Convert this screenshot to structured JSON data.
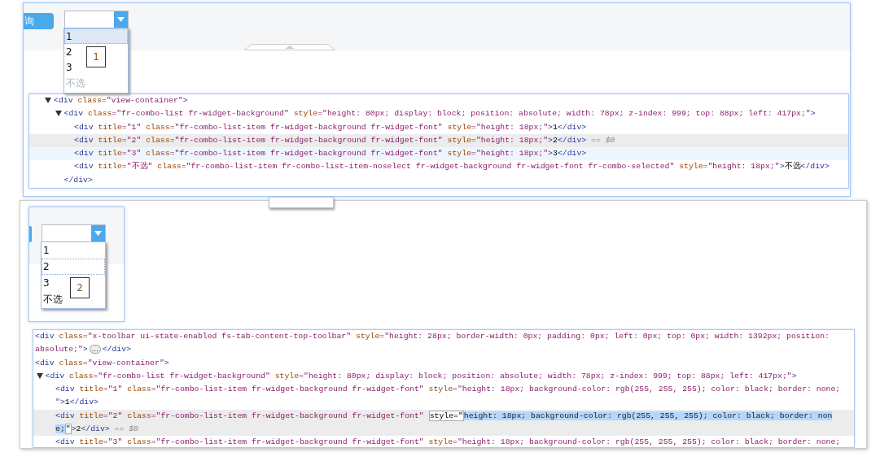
{
  "shots": [
    {
      "button": "询",
      "annotation": "1",
      "combo": {
        "items": [
          {
            "text": "1",
            "selected": true,
            "focused": true,
            "muted": false
          },
          {
            "text": "2",
            "selected": false,
            "focused": false,
            "muted": false
          },
          {
            "text": "3",
            "selected": false,
            "focused": false,
            "muted": false
          },
          {
            "text": "不选",
            "selected": false,
            "focused": false,
            "muted": true
          }
        ]
      },
      "tree": [
        {
          "expanded": true,
          "lines": [
            [
              {
                "kind": "tag",
                "text": "<div"
              },
              {
                "kind": "attr",
                "text": " class"
              },
              {
                "kind": "value",
                "text": "=\"view-container\""
              },
              {
                "kind": "tag",
                "text": ">"
              }
            ]
          ],
          "children": [
            {
              "expanded": true,
              "lines": [
                [
                  {
                    "kind": "tag",
                    "text": "<div"
                  },
                  {
                    "kind": "attr",
                    "text": " class"
                  },
                  {
                    "kind": "value",
                    "text": "=\"fr-combo-list fr-widget-background\""
                  },
                  {
                    "kind": "attr",
                    "text": " style"
                  },
                  {
                    "kind": "value",
                    "text": "=\"height: 80px; display: block; position: absolute; width: 78px; z-index: 999; top: 88px; left: 417px;\""
                  },
                  {
                    "kind": "tag",
                    "text": ">"
                  }
                ]
              ],
              "children": [
                {
                  "selected": false,
                  "hovered": false,
                  "lines": [
                    [
                      {
                        "kind": "tag",
                        "text": "<div"
                      },
                      {
                        "kind": "attr",
                        "text": " title"
                      },
                      {
                        "kind": "value",
                        "text": "=\"1\""
                      },
                      {
                        "kind": "attr",
                        "text": " class"
                      },
                      {
                        "kind": "value",
                        "text": "=\"fr-combo-list-item fr-widget-background fr-widget-font\""
                      },
                      {
                        "kind": "attr",
                        "text": " style"
                      },
                      {
                        "kind": "value",
                        "text": "=\"height: 18px;\""
                      },
                      {
                        "kind": "tag",
                        "text": ">"
                      },
                      {
                        "kind": "text",
                        "text": "1"
                      },
                      {
                        "kind": "tag",
                        "text": "</div>"
                      }
                    ]
                  ]
                },
                {
                  "selected": true,
                  "hovered": false,
                  "lines": [
                    [
                      {
                        "kind": "tag",
                        "text": "<div"
                      },
                      {
                        "kind": "attr",
                        "text": " title"
                      },
                      {
                        "kind": "value",
                        "text": "=\"2\""
                      },
                      {
                        "kind": "attr",
                        "text": " class"
                      },
                      {
                        "kind": "value",
                        "text": "=\"fr-combo-list-item fr-widget-background fr-widget-font\""
                      },
                      {
                        "kind": "attr",
                        "text": " style"
                      },
                      {
                        "kind": "value",
                        "text": "=\"height: 18px;\""
                      },
                      {
                        "kind": "tag",
                        "text": ">"
                      },
                      {
                        "kind": "text",
                        "text": "2"
                      },
                      {
                        "kind": "tag",
                        "text": "</div>"
                      },
                      {
                        "kind": "note",
                        "text": " == $0"
                      }
                    ]
                  ]
                },
                {
                  "selected": false,
                  "hovered": true,
                  "lines": [
                    [
                      {
                        "kind": "tag",
                        "text": "<div"
                      },
                      {
                        "kind": "attr",
                        "text": " title"
                      },
                      {
                        "kind": "value",
                        "text": "=\"3\""
                      },
                      {
                        "kind": "attr",
                        "text": " class"
                      },
                      {
                        "kind": "value",
                        "text": "=\"fr-combo-list-item fr-widget-background fr-widget-font\""
                      },
                      {
                        "kind": "attr",
                        "text": " style"
                      },
                      {
                        "kind": "value",
                        "text": "=\"height: 18px;\""
                      },
                      {
                        "kind": "tag",
                        "text": ">"
                      },
                      {
                        "kind": "text",
                        "text": "3"
                      },
                      {
                        "kind": "tag",
                        "text": "</div>"
                      }
                    ]
                  ]
                },
                {
                  "selected": false,
                  "hovered": false,
                  "lines": [
                    [
                      {
                        "kind": "tag",
                        "text": "<div"
                      },
                      {
                        "kind": "attr",
                        "text": " title"
                      },
                      {
                        "kind": "value",
                        "text": "=\"不选\""
                      },
                      {
                        "kind": "attr",
                        "text": " class"
                      },
                      {
                        "kind": "value",
                        "text": "=\"fr-combo-list-item fr-combo-list-item-noselect fr-widget-background fr-widget-font fr-combo-selected\""
                      },
                      {
                        "kind": "attr",
                        "text": " style"
                      },
                      {
                        "kind": "value",
                        "text": "=\"height: 18px;\""
                      },
                      {
                        "kind": "tag",
                        "text": ">"
                      },
                      {
                        "kind": "text",
                        "text": "不选"
                      },
                      {
                        "kind": "tag",
                        "text": "</div>"
                      }
                    ]
                  ]
                }
              ],
              "closing": [
                [
                  {
                    "kind": "tag",
                    "text": "</div>"
                  }
                ]
              ]
            }
          ]
        }
      ]
    },
    {
      "annotation": "2",
      "combo": {
        "items": [
          {
            "text": "1",
            "selected": false,
            "focused": false,
            "muted": false
          },
          {
            "text": "2",
            "selected": false,
            "focused": true,
            "muted": false
          },
          {
            "text": "3",
            "selected": false,
            "focused": false,
            "muted": false
          },
          {
            "text": "不选",
            "selected": false,
            "focused": false,
            "muted": false
          }
        ]
      },
      "tree": [
        {
          "lines": [
            [
              {
                "kind": "tag",
                "text": "<div"
              },
              {
                "kind": "attr",
                "text": " class"
              },
              {
                "kind": "value",
                "text": "=\"x-toolbar ui-state-enabled fs-tab-content-top-toolbar\""
              },
              {
                "kind": "attr",
                "text": " style"
              },
              {
                "kind": "value",
                "text": "=\"height: 28px; border-width: 0px; padding: 0px; left: 0px; top: 0px; width: 1392px; position:"
              }
            ],
            [
              {
                "kind": "value",
                "text": "absolute;\""
              },
              {
                "kind": "tag",
                "text": ">"
              },
              {
                "kind": "ellipsis",
                "text": "…"
              },
              {
                "kind": "tag",
                "text": "</div>"
              }
            ]
          ]
        },
        {
          "lines": [
            [
              {
                "kind": "tag",
                "text": "<div"
              },
              {
                "kind": "attr",
                "text": " class"
              },
              {
                "kind": "value",
                "text": "=\"view-container\""
              },
              {
                "kind": "tag",
                "text": ">"
              }
            ]
          ],
          "children": [
            {
              "expanded": true,
              "lines": [
                [
                  {
                    "kind": "tag",
                    "text": "<div"
                  },
                  {
                    "kind": "attr",
                    "text": " class"
                  },
                  {
                    "kind": "value",
                    "text": "=\"fr-combo-list fr-widget-background\""
                  },
                  {
                    "kind": "attr",
                    "text": " style"
                  },
                  {
                    "kind": "value",
                    "text": "=\"height: 80px; display: block; position: absolute; width: 78px; z-index: 999; top: 88px; left: 417px;\""
                  },
                  {
                    "kind": "tag",
                    "text": ">"
                  }
                ]
              ],
              "children": [
                {
                  "selected": false,
                  "hovered": false,
                  "lines": [
                    [
                      {
                        "kind": "tag",
                        "text": "<div"
                      },
                      {
                        "kind": "attr",
                        "text": " title"
                      },
                      {
                        "kind": "value",
                        "text": "=\"1\""
                      },
                      {
                        "kind": "attr",
                        "text": " class"
                      },
                      {
                        "kind": "value",
                        "text": "=\"fr-combo-list-item fr-widget-background fr-widget-font\""
                      },
                      {
                        "kind": "attr",
                        "text": " style"
                      },
                      {
                        "kind": "value",
                        "text": "=\"height: 18px; background-color: rgb(255, 255, 255); color: black; border: none;"
                      }
                    ],
                    [
                      {
                        "kind": "value",
                        "text": "\""
                      },
                      {
                        "kind": "tag",
                        "text": ">"
                      },
                      {
                        "kind": "text",
                        "text": "1"
                      },
                      {
                        "kind": "tag",
                        "text": "</div>"
                      }
                    ]
                  ]
                },
                {
                  "selected": true,
                  "hovered": false,
                  "lines": [
                    [
                      {
                        "kind": "tag",
                        "text": "<div"
                      },
                      {
                        "kind": "attr",
                        "text": " title"
                      },
                      {
                        "kind": "value",
                        "text": "=\"2\""
                      },
                      {
                        "kind": "attr",
                        "text": " class"
                      },
                      {
                        "kind": "value",
                        "text": "=\"fr-combo-list-item fr-widget-background fr-widget-font\" "
                      },
                      {
                        "kind": "edit",
                        "text": "style=\""
                      },
                      {
                        "kind": "sel",
                        "text": "height: 18px; background-color: rgb(255, 255, 255); color: black; border: non"
                      }
                    ],
                    [
                      {
                        "kind": "sel",
                        "text": "e;"
                      },
                      {
                        "kind": "edit",
                        "text": "\""
                      },
                      {
                        "kind": "tag",
                        "text": ">"
                      },
                      {
                        "kind": "text",
                        "text": "2"
                      },
                      {
                        "kind": "tag",
                        "text": "</div>"
                      },
                      {
                        "kind": "note",
                        "text": " == $0"
                      }
                    ]
                  ]
                },
                {
                  "selected": false,
                  "hovered": false,
                  "lines": [
                    [
                      {
                        "kind": "tag",
                        "text": "<div"
                      },
                      {
                        "kind": "attr",
                        "text": " title"
                      },
                      {
                        "kind": "value",
                        "text": "=\"3\""
                      },
                      {
                        "kind": "attr",
                        "text": " class"
                      },
                      {
                        "kind": "value",
                        "text": "=\"fr-combo-list-item fr-widget-background fr-widget-font\""
                      },
                      {
                        "kind": "attr",
                        "text": " style"
                      },
                      {
                        "kind": "value",
                        "text": "=\"height: 18px; background-color: rgb(255, 255, 255); color: black; border: none;"
                      }
                    ]
                  ]
                }
              ]
            }
          ]
        }
      ]
    }
  ]
}
